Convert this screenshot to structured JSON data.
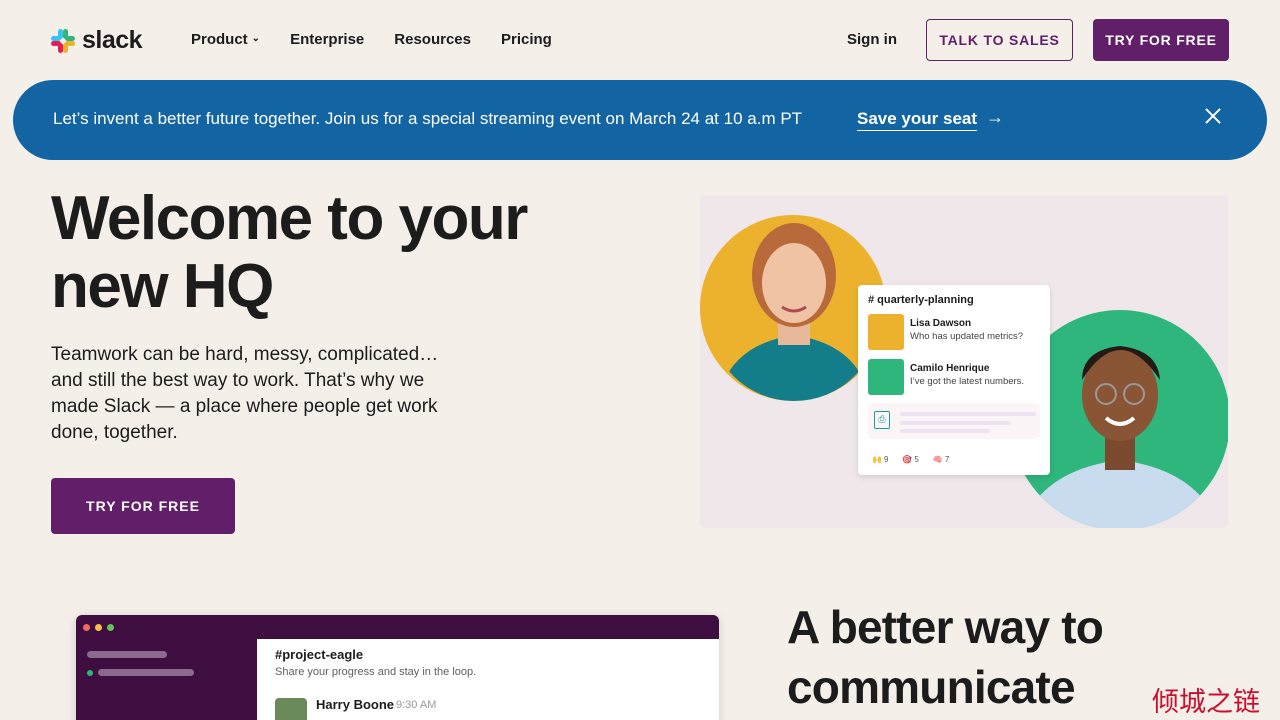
{
  "brand": {
    "name": "slack",
    "purple": "#611f69",
    "blue": "#1264a3"
  },
  "nav": {
    "links": [
      {
        "label": "Product",
        "has_dropdown": true
      },
      {
        "label": "Enterprise"
      },
      {
        "label": "Resources"
      },
      {
        "label": "Pricing"
      }
    ],
    "sign_in": "Sign in",
    "talk_to_sales": "TALK TO SALES",
    "try_free": "TRY FOR FREE"
  },
  "banner": {
    "text": "Let’s invent a better future together. Join us for a special streaming event on March 24 at 10 a.m PT",
    "link": "Save your seat",
    "arrow": "→",
    "close_icon": "close-icon"
  },
  "hero": {
    "title_line1": "Welcome to your",
    "title_line2": "new HQ",
    "body": "Teamwork can be hard, messy, complicated… and still the best way to work. That’s why we made Slack — a place where people get work done, together.",
    "cta": "TRY FOR FREE"
  },
  "illustration": {
    "channel": "# quarterly-planning",
    "messages": [
      {
        "name": "Lisa Dawson",
        "text": "Who has updated metrics?",
        "color": "#ecb22e"
      },
      {
        "name": "Camilo Henrique",
        "text": "I’ve got the latest numbers.",
        "color": "#2eb67d"
      }
    ],
    "reactions": [
      {
        "emoji": "🙌",
        "count": "9"
      },
      {
        "emoji": "🎯",
        "count": "5"
      },
      {
        "emoji": "🧠",
        "count": "7"
      }
    ]
  },
  "app_preview": {
    "channel": "#project-eagle",
    "description": "Share your progress and stay in the loop.",
    "user": "Harry Boone",
    "time": "9:30 AM"
  },
  "section2": {
    "title": "A better way to communicate"
  },
  "watermark": "倾城之链"
}
